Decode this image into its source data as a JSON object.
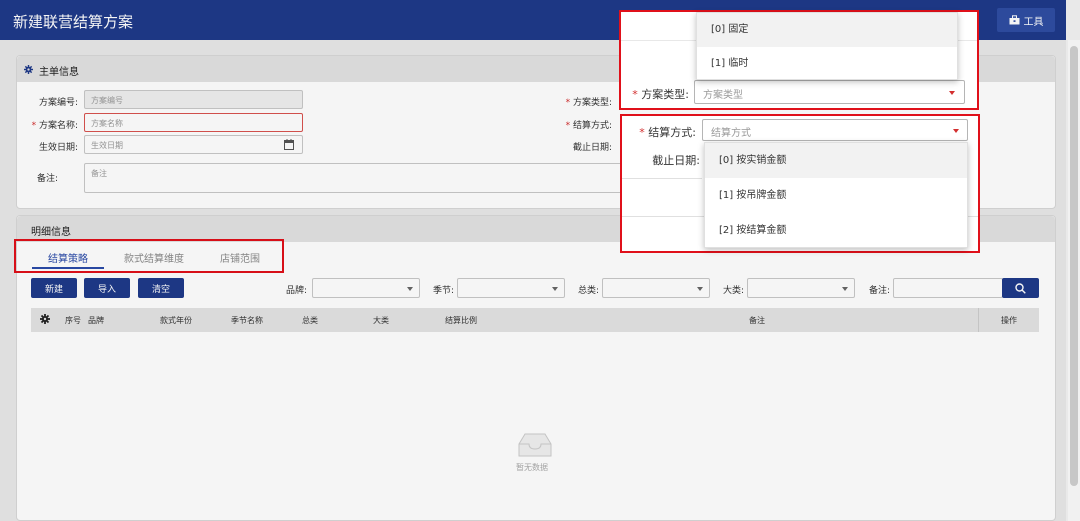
{
  "app": {
    "title": "新建联营结算方案",
    "tool_label": "工具",
    "tool_icon": "toolbox-icon"
  },
  "main_info": {
    "header": "主单信息",
    "fields": {
      "scheme_no": {
        "label": "方案编号:",
        "placeholder": "方案编号"
      },
      "scheme_name": {
        "label": "方案名称:",
        "placeholder": "方案名称"
      },
      "effective_date": {
        "label": "生效日期:",
        "placeholder": "生效日期"
      },
      "remark": {
        "label": "备注:",
        "placeholder": "备注"
      },
      "scheme_type": {
        "label": "方案类型:"
      },
      "settle_method": {
        "label": "结算方式:"
      },
      "end_date": {
        "label": "截止日期:"
      }
    }
  },
  "detail": {
    "header": "明细信息",
    "tabs": [
      "结算策略",
      "款式结算维度",
      "店铺范围"
    ],
    "buttons": {
      "new": "新建",
      "import": "导入",
      "clear": "清空"
    },
    "filters": {
      "brand": "品牌:",
      "season": "季节:",
      "category": "总类:",
      "major": "大类:",
      "remark": "备注:"
    },
    "columns": [
      "序号",
      "品牌",
      "款式年份",
      "季节名称",
      "总类",
      "大类",
      "结算比例",
      "备注",
      "操作"
    ],
    "empty_text": "暂无数据"
  },
  "popup_type": {
    "options": [
      "[0] 固定",
      "[1] 临时"
    ],
    "label": "方案类型:",
    "placeholder": "方案类型"
  },
  "popup_settle": {
    "label": "结算方式:",
    "placeholder": "结算方式",
    "behind_label": "截止日期:",
    "options": [
      "[0] 按实销金额",
      "[1] 按吊牌金额",
      "[2] 按结算金额"
    ]
  },
  "colors": {
    "brand": "#1f3a8a",
    "highlight": "#e0101a"
  }
}
